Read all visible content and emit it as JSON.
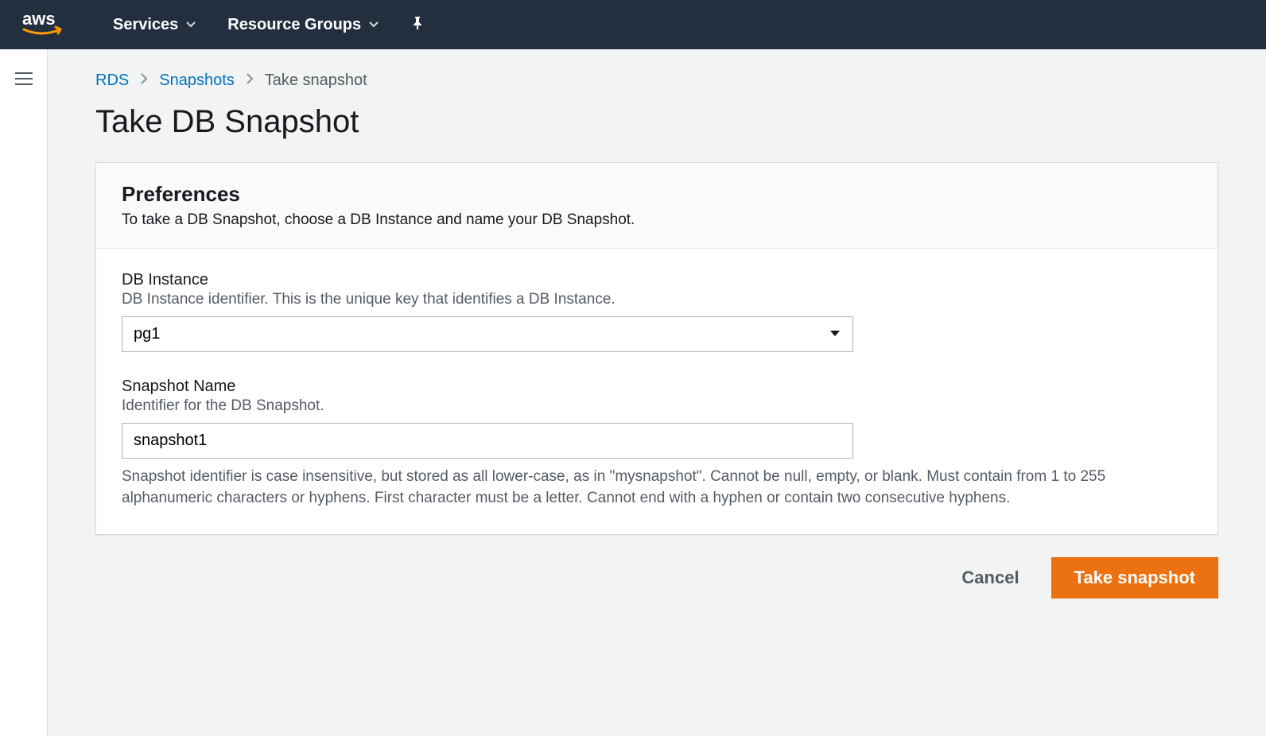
{
  "nav": {
    "services_label": "Services",
    "resource_groups_label": "Resource Groups"
  },
  "breadcrumb": {
    "root": "RDS",
    "mid": "Snapshots",
    "current": "Take snapshot"
  },
  "page": {
    "title": "Take DB Snapshot"
  },
  "preferences": {
    "heading": "Preferences",
    "description": "To take a DB Snapshot, choose a DB Instance and name your DB Snapshot."
  },
  "form": {
    "db_instance": {
      "label": "DB Instance",
      "description": "DB Instance identifier. This is the unique key that identifies a DB Instance.",
      "selected": "pg1"
    },
    "snapshot_name": {
      "label": "Snapshot Name",
      "description": "Identifier for the DB Snapshot.",
      "value": "snapshot1",
      "constraint": "Snapshot identifier is case insensitive, but stored as all lower-case, as in \"mysnapshot\". Cannot be null, empty, or blank. Must contain from 1 to 255 alphanumeric characters or hyphens. First character must be a letter. Cannot end with a hyphen or contain two consecutive hyphens."
    }
  },
  "actions": {
    "cancel_label": "Cancel",
    "primary_label": "Take snapshot"
  }
}
